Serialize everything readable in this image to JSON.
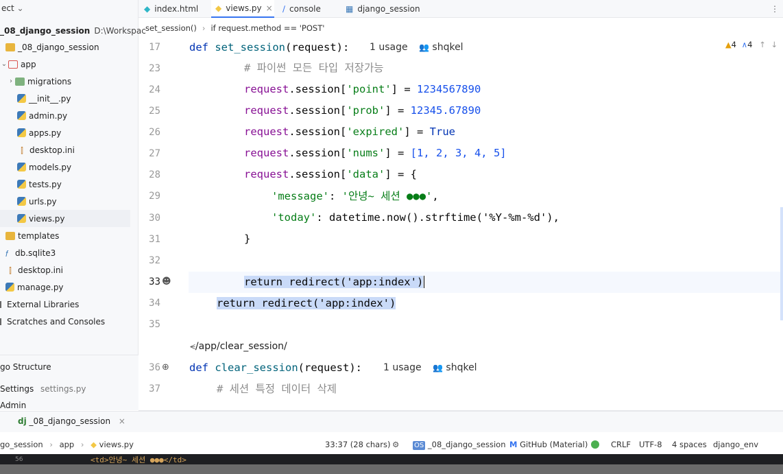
{
  "project": {
    "header": "ect",
    "root_name": "_08_django_session",
    "root_path": "D:\\Workspac",
    "items": [
      {
        "label": "_08_django_session",
        "type": "folder"
      },
      {
        "label": "app",
        "type": "folder-open"
      },
      {
        "label": "migrations",
        "type": "folder"
      },
      {
        "label": "__init__.py",
        "type": "py"
      },
      {
        "label": "admin.py",
        "type": "py"
      },
      {
        "label": "apps.py",
        "type": "py"
      },
      {
        "label": "desktop.ini",
        "type": "ini"
      },
      {
        "label": "models.py",
        "type": "py"
      },
      {
        "label": "tests.py",
        "type": "py"
      },
      {
        "label": "urls.py",
        "type": "py"
      },
      {
        "label": "views.py",
        "type": "py"
      },
      {
        "label": "templates",
        "type": "folder"
      },
      {
        "label": "db.sqlite3",
        "type": "db"
      },
      {
        "label": "desktop.ini",
        "type": "ini"
      },
      {
        "label": "manage.py",
        "type": "py"
      },
      {
        "label": "External Libraries",
        "type": "lib"
      },
      {
        "label": "Scratches and Consoles",
        "type": "scratch"
      }
    ]
  },
  "structure": {
    "title": "go Structure",
    "settings_label": "Settings",
    "settings_file": "settings.py",
    "admin_label": "Admin"
  },
  "tabs": [
    {
      "label": "index.html"
    },
    {
      "label": "views.py"
    },
    {
      "label": "console"
    },
    {
      "label": "django_session"
    }
  ],
  "breadcrumbs": [
    "set_session()",
    "if request.method == 'POST'"
  ],
  "inspections": {
    "warnings": "4",
    "typos": "4"
  },
  "editor": {
    "line_numbers": [
      "17",
      "23",
      "24",
      "25",
      "26",
      "27",
      "28",
      "29",
      "30",
      "31",
      "32",
      "33",
      "34",
      "35",
      "36",
      "37"
    ],
    "usage1": "1 usage",
    "author1": "shqkel",
    "usage2": "1 usage",
    "author2": "shqkel",
    "route": "/app/clear_session/",
    "l17_def": "def",
    "l17_name": "set_session",
    "l17_rest": "(request):",
    "l23": "# 파이썬 모든 타입 저장가능",
    "l24_a": "request",
    "l24_b": ".session[",
    "l24_c": "'point'",
    "l24_d": "] = ",
    "l24_e": "1234567890",
    "l25_c": "'prob'",
    "l25_e": "12345.67890",
    "l26_c": "'expired'",
    "l26_e": "True",
    "l27_c": "'nums'",
    "l27_e": "[1, 2, 3, 4, 5]",
    "l28_c": "'data'",
    "l28_e": "{",
    "l29_k": "'message'",
    "l29_v": "'안녕~ 세션 ●●●'",
    "l30_k": "'today'",
    "l30_v": "datetime.now().strftime('%Y-%m-%d'),",
    "l31": "}",
    "l33": "return redirect('app:index')",
    "l34": "return redirect('app:index')",
    "l36_def": "def",
    "l36_name": "clear_session",
    "l36_rest": "(request):",
    "l37": "# 세션 특정 데이터 삭제"
  },
  "run": {
    "label": "_08_django_session"
  },
  "statusbar": {
    "path": [
      "go_session",
      "app",
      "views.py"
    ],
    "position": "33:37 (28 chars)",
    "project_badge": "OS",
    "project": "_08_django_session",
    "theme": "GitHub (Material)",
    "line_sep": "CRLF",
    "encoding": "UTF-8",
    "indent": "4 spaces",
    "interpreter": "django_env"
  },
  "strip_text": "<td>안녕~ 세션 ●●●</td>"
}
